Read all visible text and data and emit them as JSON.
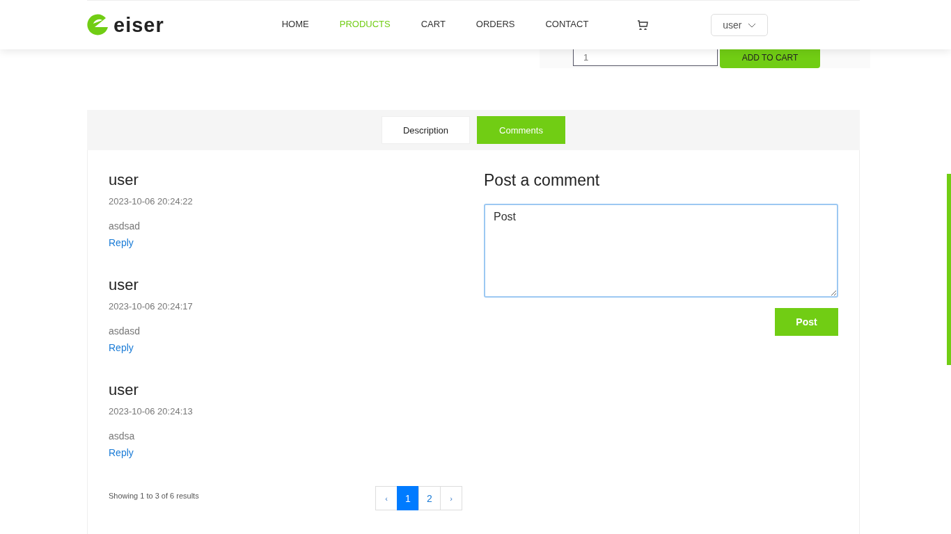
{
  "header": {
    "logo": "eiser",
    "nav": [
      {
        "label": "HOME",
        "selected": false
      },
      {
        "label": "PRODUCTS",
        "selected": true
      },
      {
        "label": "CART",
        "selected": false
      },
      {
        "label": "ORDERS",
        "selected": false
      },
      {
        "label": "CONTACT",
        "selected": false
      }
    ],
    "user_menu": "user"
  },
  "purchase": {
    "quantity": "1",
    "add_button": "ADD TO CART"
  },
  "tabs": [
    {
      "label": "Description",
      "selected": false
    },
    {
      "label": "Comments",
      "selected": true
    }
  ],
  "comments": [
    {
      "author": "user",
      "date": "2023-10-06 20:24:22",
      "text": "asdsad",
      "reply": "Reply"
    },
    {
      "author": "user",
      "date": "2023-10-06 20:24:17",
      "text": "asdasd",
      "reply": "Reply"
    },
    {
      "author": "user",
      "date": "2023-10-06 20:24:13",
      "text": "asdsa",
      "reply": "Reply"
    }
  ],
  "results_summary": "Showing 1 to 3 of 6 results",
  "pagination": [
    {
      "label": "‹",
      "kind": "prev",
      "selected": false
    },
    {
      "label": "1",
      "kind": "page",
      "selected": true
    },
    {
      "label": "2",
      "kind": "page",
      "selected": false
    },
    {
      "label": "›",
      "kind": "next",
      "selected": false
    }
  ],
  "comment_form": {
    "title": "Post a comment",
    "value": "Post",
    "submit": "Post"
  }
}
